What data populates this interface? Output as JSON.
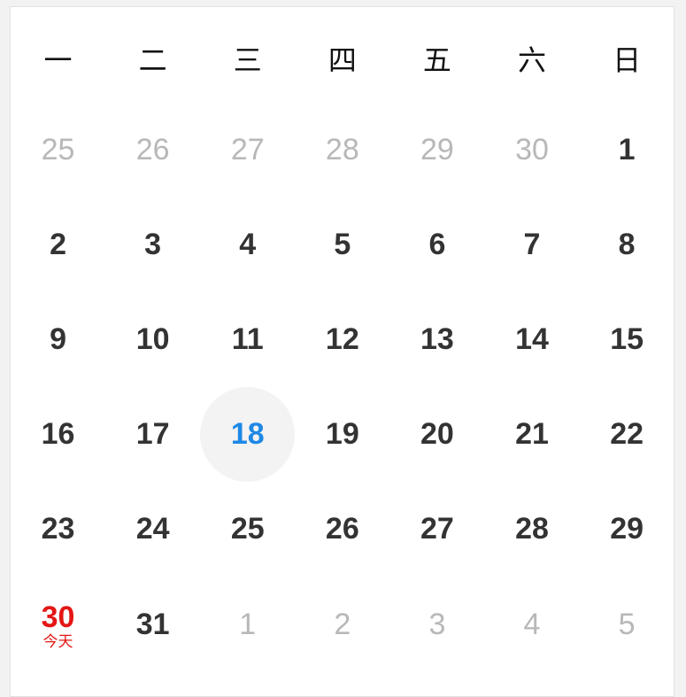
{
  "weekdays": [
    "一",
    "二",
    "三",
    "四",
    "五",
    "六",
    "日"
  ],
  "days": [
    {
      "n": "25",
      "type": "other"
    },
    {
      "n": "26",
      "type": "other"
    },
    {
      "n": "27",
      "type": "other"
    },
    {
      "n": "28",
      "type": "other"
    },
    {
      "n": "29",
      "type": "other"
    },
    {
      "n": "30",
      "type": "other"
    },
    {
      "n": "1",
      "type": "cur"
    },
    {
      "n": "2",
      "type": "cur"
    },
    {
      "n": "3",
      "type": "cur"
    },
    {
      "n": "4",
      "type": "cur"
    },
    {
      "n": "5",
      "type": "cur"
    },
    {
      "n": "6",
      "type": "cur"
    },
    {
      "n": "7",
      "type": "cur"
    },
    {
      "n": "8",
      "type": "cur"
    },
    {
      "n": "9",
      "type": "cur"
    },
    {
      "n": "10",
      "type": "cur"
    },
    {
      "n": "11",
      "type": "cur"
    },
    {
      "n": "12",
      "type": "cur"
    },
    {
      "n": "13",
      "type": "cur"
    },
    {
      "n": "14",
      "type": "cur"
    },
    {
      "n": "15",
      "type": "cur"
    },
    {
      "n": "16",
      "type": "cur"
    },
    {
      "n": "17",
      "type": "cur"
    },
    {
      "n": "18",
      "type": "cur",
      "selected": true
    },
    {
      "n": "19",
      "type": "cur"
    },
    {
      "n": "20",
      "type": "cur"
    },
    {
      "n": "21",
      "type": "cur"
    },
    {
      "n": "22",
      "type": "cur"
    },
    {
      "n": "23",
      "type": "cur"
    },
    {
      "n": "24",
      "type": "cur"
    },
    {
      "n": "25",
      "type": "cur"
    },
    {
      "n": "26",
      "type": "cur"
    },
    {
      "n": "27",
      "type": "cur"
    },
    {
      "n": "28",
      "type": "cur"
    },
    {
      "n": "29",
      "type": "cur"
    },
    {
      "n": "30",
      "type": "cur",
      "today": true
    },
    {
      "n": "31",
      "type": "cur"
    },
    {
      "n": "1",
      "type": "other"
    },
    {
      "n": "2",
      "type": "other"
    },
    {
      "n": "3",
      "type": "other"
    },
    {
      "n": "4",
      "type": "other"
    },
    {
      "n": "5",
      "type": "other"
    }
  ],
  "today_label": "今天",
  "colors": {
    "selected_text": "#1e88e5",
    "today_text": "#e31616",
    "selected_bg": "#f3f3f3",
    "current_month_text": "#333333",
    "other_month_text": "#b8b8b8"
  }
}
